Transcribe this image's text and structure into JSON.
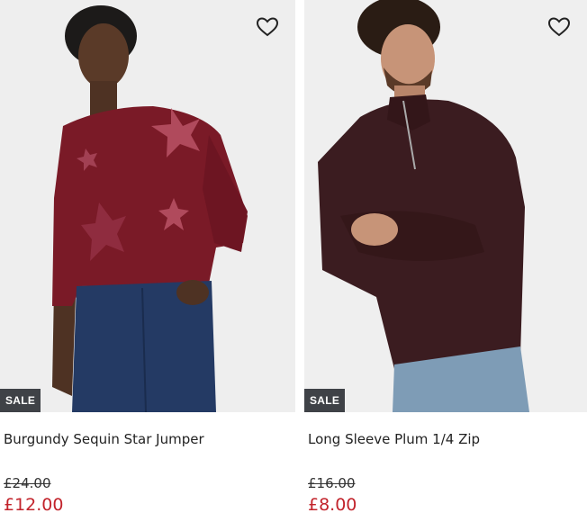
{
  "products": [
    {
      "name": "Burgundy Sequin Star Jumper",
      "badge": "SALE",
      "was_price": "£24.00",
      "now_price": "£12.00",
      "image": "woman in burgundy sequin star jumper and blue jeans",
      "icon": "heart-outline-icon"
    },
    {
      "name": "Long Sleeve Plum 1/4 Zip",
      "badge": "SALE",
      "was_price": "£16.00",
      "now_price": "£8.00",
      "image": "man in plum quarter-zip jumper and light jeans",
      "icon": "heart-outline-icon"
    }
  ],
  "colors": {
    "sale_badge_bg": "#3f4247",
    "sale_price": "#c2232b",
    "photo_bg": "#efefef"
  }
}
